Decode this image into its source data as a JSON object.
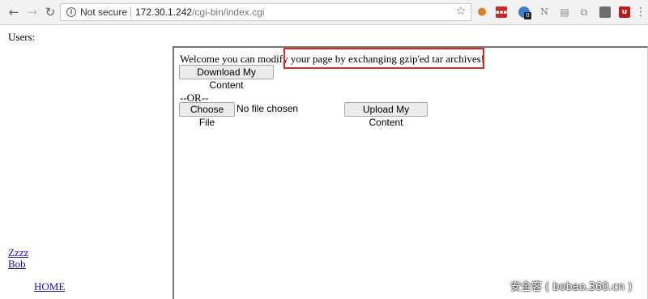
{
  "browser": {
    "security_label": "Not secure",
    "url_host": "172.30.1.242",
    "url_path": "/cgi-bin/index.cgi",
    "icons": {
      "back": "arrow-left-icon",
      "forward": "arrow-right-icon",
      "reload": "reload-icon",
      "info": "info-icon",
      "bookmark": "star-icon",
      "menu": "kebab-menu-icon"
    },
    "extensions": [
      {
        "name": "cookie-extension-icon",
        "glyph": "●",
        "color": "#d9822b"
      },
      {
        "name": "red-extension-icon",
        "glyph": "▪▪▪",
        "color": "#c62828"
      },
      {
        "name": "blue-extension-icon",
        "glyph": "⬣",
        "color": "#3f7fd1"
      },
      {
        "name": "notes-extension-icon",
        "glyph": "N",
        "color": "#9e9e9e"
      },
      {
        "name": "doc-extension-icon",
        "glyph": "▤",
        "color": "#9e9e9e"
      },
      {
        "name": "tabs-extension-icon",
        "glyph": "⧉",
        "color": "#9e9e9e"
      },
      {
        "name": "square-extension-icon",
        "glyph": "■",
        "color": "#6d6d6d"
      },
      {
        "name": "ublock-extension-icon",
        "glyph": "u",
        "color": "#b71c1c"
      }
    ],
    "extension_badge": "0"
  },
  "sidebar": {
    "users_label": "Users:",
    "users": [
      "Zzzz",
      "Bob"
    ],
    "home_label": "HOME"
  },
  "main": {
    "welcome_text": "Welcome you can modify your page by exchanging gzip'ed tar archives!",
    "download_label": "Download My Content",
    "or_text": "--OR--",
    "choose_file_label": "Choose File",
    "no_file_text": "No file chosen",
    "upload_label": "Upload My Content"
  },
  "watermark": "安全客 ( bobao.360.cn )",
  "colors": {
    "highlight": "#d92b2b",
    "link": "#1a0dab"
  }
}
